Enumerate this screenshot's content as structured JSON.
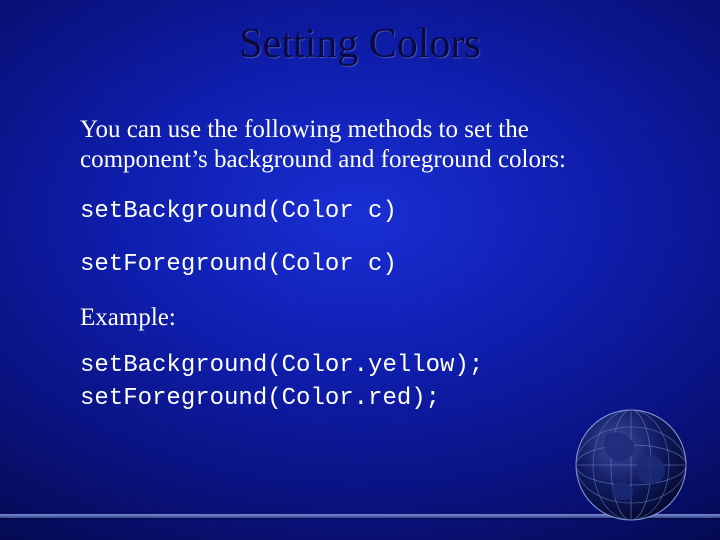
{
  "title": "Setting Colors",
  "intro": "You can use the following methods to set the component’s background and foreground colors:",
  "methods": {
    "setBackground": "setBackground(Color c)",
    "setForeground": "setForeground(Color c)"
  },
  "exampleLabel": "Example:",
  "exampleCode": {
    "line1": "setBackground(Color.yellow);",
    "line2": "setForeground(Color.red);"
  }
}
